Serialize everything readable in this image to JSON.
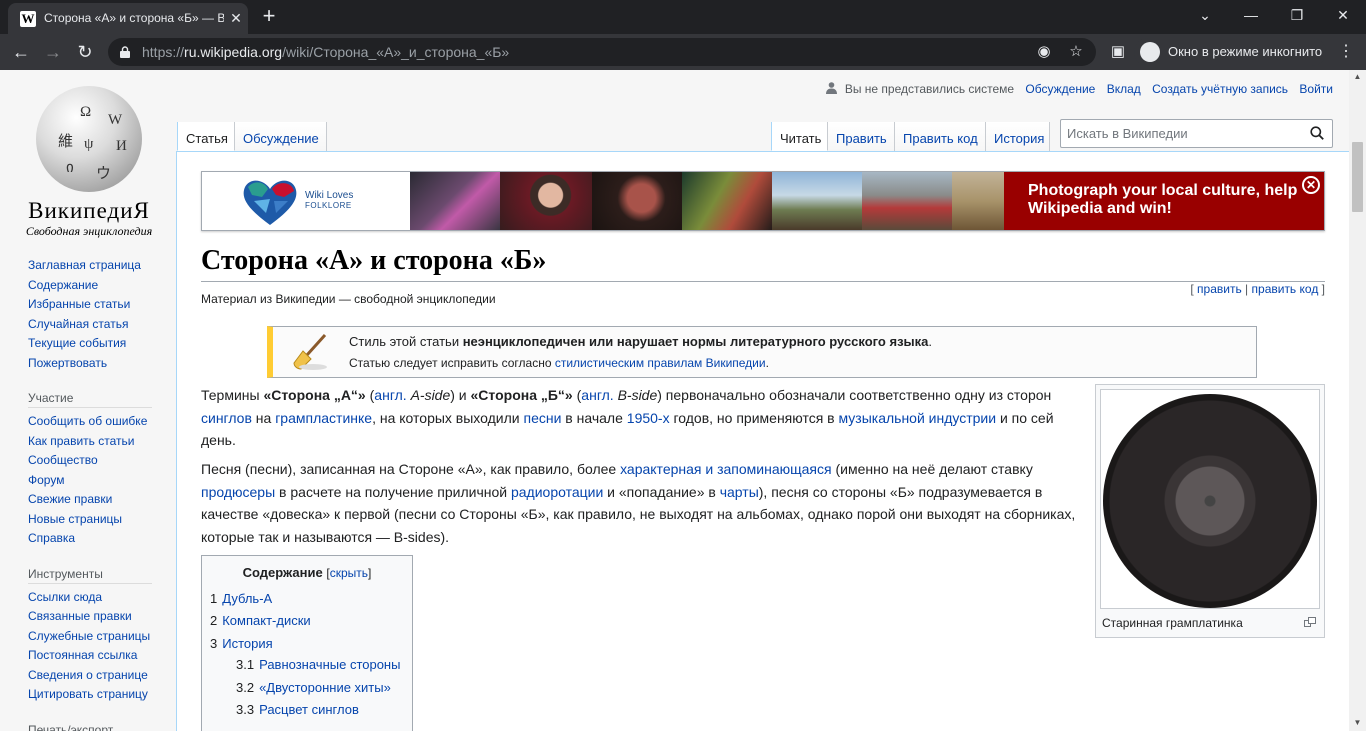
{
  "browser": {
    "tab_title": "Сторона «А» и сторона «Б» — В",
    "url_host": "ru.wikipedia.org",
    "url_path": "/wiki/Сторона_«А»_и_сторона_«Б»",
    "url_scheme": "https://",
    "incognito_label": "Окно в режиме инкогнито"
  },
  "logo": {
    "wordmark": "ВикипедиЯ",
    "tagline": "Свободная энциклопедия"
  },
  "sidebar": {
    "nav": [
      "Заглавная страница",
      "Содержание",
      "Избранные статьи",
      "Случайная статья",
      "Текущие события",
      "Пожертвовать"
    ],
    "participation_heading": "Участие",
    "participation": [
      "Сообщить об ошибке",
      "Как править статьи",
      "Сообщество",
      "Форум",
      "Свежие правки",
      "Новые страницы",
      "Справка"
    ],
    "tools_heading": "Инструменты",
    "tools": [
      "Ссылки сюда",
      "Связанные правки",
      "Служебные страницы",
      "Постоянная ссылка",
      "Сведения о странице",
      "Цитировать страницу"
    ],
    "print_heading": "Печать/экспорт"
  },
  "personal": {
    "anon": "Вы не представились системе",
    "talk": "Обсуждение",
    "contribs": "Вклад",
    "create": "Создать учётную запись",
    "login": "Войти"
  },
  "tabs": {
    "article": "Статья",
    "talk": "Обсуждение",
    "read": "Читать",
    "edit": "Править",
    "edit_source": "Править код",
    "history": "История"
  },
  "search": {
    "placeholder": "Искать в Википедии"
  },
  "banner": {
    "campaign_name": "Wiki Loves",
    "campaign_sub": "FOLKLORE",
    "cta": "Photograph your local culture, help Wikipedia and win!"
  },
  "article": {
    "title": "Сторона «А» и сторона «Б»",
    "subtitle": "Материал из Википедии — свободной энциклопедии",
    "edit": "править",
    "edit_source": "править код",
    "notice_pre": "Стиль этой статьи ",
    "notice_bold": "неэнциклопедичен или нарушает нормы литературного русского языка",
    "notice_post": ".",
    "notice_line2_pre": "Статью следует исправить согласно ",
    "notice_line2_link": "стилистическим правилам Википедии",
    "notice_line2_post": ".",
    "thumb_caption": "Старинная грамплатинка"
  },
  "toc": {
    "title": "Содержание",
    "hide": "скрыть",
    "items": [
      {
        "num": "1",
        "label": "Дубль-А"
      },
      {
        "num": "2",
        "label": "Компакт-диски"
      },
      {
        "num": "3",
        "label": "История"
      },
      {
        "num": "3.1",
        "label": "Равнозначные стороны"
      },
      {
        "num": "3.2",
        "label": "«Двусторонние хиты»"
      },
      {
        "num": "3.3",
        "label": "Расцвет синглов"
      }
    ]
  },
  "colors": {
    "link": "#0645ad",
    "banner_red": "#990000",
    "notice_bar": "#ffcc33",
    "chrome_dark": "#202124"
  }
}
